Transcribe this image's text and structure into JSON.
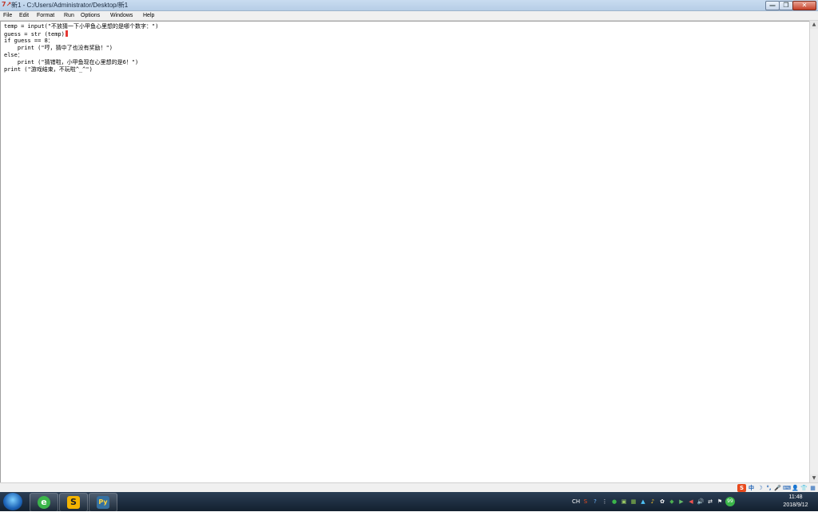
{
  "window": {
    "title": "新1 - C:/Users/Administrator/Desktop/新1",
    "icon": "idle-icon",
    "controls": {
      "minimize": "—",
      "maximize": "❐",
      "close": "✕"
    }
  },
  "menu": {
    "items": [
      "File",
      "Edit",
      "Format",
      "Run",
      "Options",
      "Windows",
      "Help"
    ]
  },
  "editor": {
    "lines": [
      "temp = input(\"不放猜一下小甲鱼心里想的是哪个数字：\")",
      "guess = str (temp)",
      "if guess == 8：",
      "    print (\"哼，猜中了也没有奖励！\")",
      "else：",
      "    print (\"猜错啦，小甲鱼现在心里想的是6！\")",
      "print (\"游戏结束，不玩啦^_^\")"
    ],
    "cursor_line": 1
  },
  "ime_toolbar": {
    "items": [
      "S",
      "中",
      "☽",
      "°,",
      "🎤",
      "⌨",
      "👤",
      "👕",
      "▦"
    ]
  },
  "taskbar": {
    "apps": [
      {
        "name": "360-browser",
        "glyph": "e",
        "color": "#3bb54a"
      },
      {
        "name": "sublime",
        "glyph": "S",
        "color": "#f4b400"
      },
      {
        "name": "python-idle",
        "glyph": "Py",
        "color": "#3670a0"
      }
    ],
    "tray": [
      "CH",
      "S",
      "?",
      "⋮",
      "●",
      "▣",
      "▦",
      "▲",
      "♪",
      "✿",
      "◆",
      "▶",
      "◀",
      "🔊",
      "⇄",
      "⚑",
      "99"
    ],
    "clock": {
      "time": "11:48",
      "date": "2018/9/12"
    }
  },
  "colors": {
    "cursor": "#e53935",
    "title_bg": "#c9dcf0",
    "taskbar_bg": "#1b2b3f"
  }
}
